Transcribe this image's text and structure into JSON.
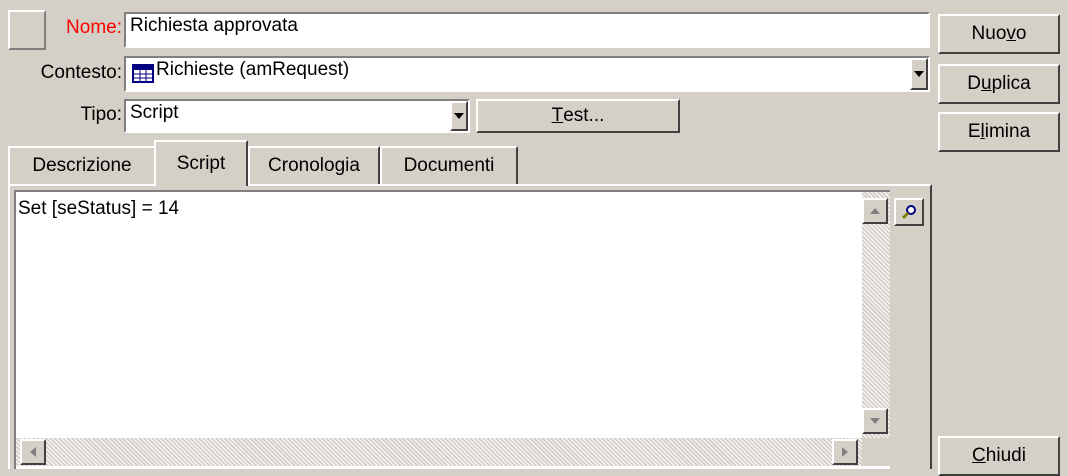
{
  "form": {
    "name_label": "Nome:",
    "name_value": "Richiesta approvata",
    "context_label": "Contesto:",
    "context_value": "Richieste (amRequest)",
    "type_label": "Tipo:",
    "type_value": "Script",
    "test_button": {
      "accel": "T",
      "rest": "est..."
    }
  },
  "tabs": [
    {
      "label": "Descrizione"
    },
    {
      "label": "Script",
      "active": true
    },
    {
      "label": "Cronologia"
    },
    {
      "label": "Documenti"
    }
  ],
  "script": {
    "content": "Set [seStatus] = 14"
  },
  "actions": {
    "new": {
      "pre": "Nuo",
      "accel": "v",
      "post": "o"
    },
    "duplicate": {
      "pre": "D",
      "accel": "u",
      "post": "plica"
    },
    "delete": {
      "pre": "E",
      "accel": "l",
      "post": "imina"
    },
    "close": {
      "pre": "",
      "accel": "C",
      "post": "hiudi"
    }
  },
  "colors": {
    "required_label": "#ff0000",
    "face": "#d4d0c8",
    "text": "#000000"
  },
  "icons": [
    "table-icon",
    "dropdown-arrow-icon",
    "search-icon",
    "scroll-up-arrow-icon",
    "scroll-down-arrow-icon",
    "scroll-left-arrow-icon",
    "scroll-right-arrow-icon"
  ]
}
